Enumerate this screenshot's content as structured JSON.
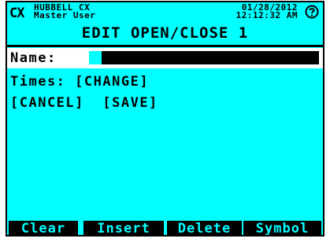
{
  "header": {
    "logo": "CX",
    "brand": "HUBBELL CX",
    "user": "Master User",
    "date": "01/28/2012",
    "time": "12:12:32 AM",
    "help_icon": "help-icon"
  },
  "page": {
    "title": "EDIT OPEN/CLOSE 1"
  },
  "form": {
    "name_label": "Name:",
    "name_value": "",
    "times_label": "Times:",
    "change_link": "[CHANGE]",
    "cancel_link": "[CANCEL]",
    "save_link": "[SAVE]"
  },
  "softkeys": {
    "clear": "Clear",
    "insert": "Insert",
    "delete": "Delete",
    "symbol": "Symbol"
  },
  "colors": {
    "screen_bg": "#00ffff",
    "text": "#000000",
    "highlight": "#ffffff"
  }
}
